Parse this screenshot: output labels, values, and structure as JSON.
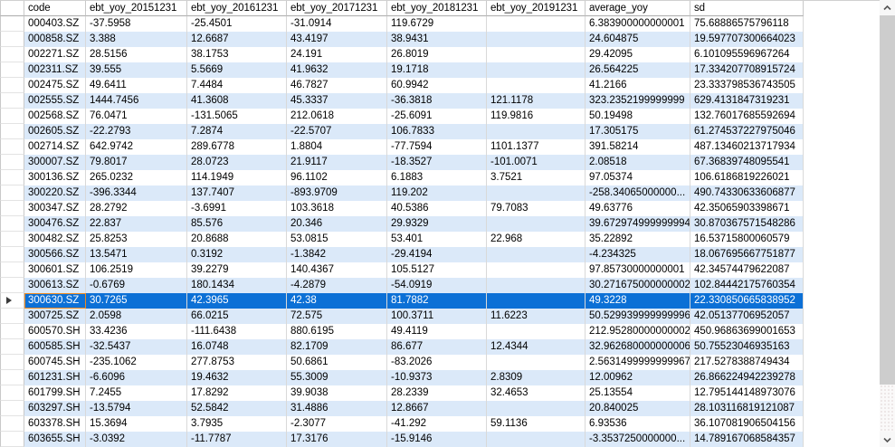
{
  "table": {
    "columns": [
      "code",
      "ebt_yoy_20151231",
      "ebt_yoy_20161231",
      "ebt_yoy_20171231",
      "ebt_yoy_20181231",
      "ebt_yoy_20191231",
      "average_yoy",
      "sd"
    ],
    "selected_index": 18,
    "rows": [
      [
        "000403.SZ",
        "-37.5958",
        "-25.4501",
        "-31.0914",
        "119.6729",
        "",
        "6.383900000000001",
        "75.68886575796118"
      ],
      [
        "000858.SZ",
        "3.388",
        "12.6687",
        "43.4197",
        "38.9431",
        "",
        "24.604875",
        "19.597707300664023"
      ],
      [
        "002271.SZ",
        "28.5156",
        "38.1753",
        "24.191",
        "26.8019",
        "",
        "29.42095",
        "6.101095596967264"
      ],
      [
        "002311.SZ",
        "39.555",
        "5.5669",
        "41.9632",
        "19.1718",
        "",
        "26.564225",
        "17.334207708915724"
      ],
      [
        "002475.SZ",
        "49.6411",
        "7.4484",
        "46.7827",
        "60.9942",
        "",
        "41.2166",
        "23.333798536743505"
      ],
      [
        "002555.SZ",
        "1444.7456",
        "41.3608",
        "45.3337",
        "-36.3818",
        "121.1178",
        "323.2352199999999",
        "629.4131847319231"
      ],
      [
        "002568.SZ",
        "76.0471",
        "-131.5065",
        "212.0618",
        "-25.6091",
        "119.9816",
        "50.19498",
        "132.76017685592694"
      ],
      [
        "002605.SZ",
        "-22.2793",
        "7.2874",
        "-22.5707",
        "106.7833",
        "",
        "17.305175",
        "61.274537227975046"
      ],
      [
        "002714.SZ",
        "642.9742",
        "289.6778",
        "1.8804",
        "-77.7594",
        "1101.1377",
        "391.58214",
        "487.13460213717934"
      ],
      [
        "300007.SZ",
        "79.8017",
        "28.0723",
        "21.9117",
        "-18.3527",
        "-101.0071",
        "2.08518",
        "67.36839748095541"
      ],
      [
        "300136.SZ",
        "265.0232",
        "114.1949",
        "96.1102",
        "6.1883",
        "3.7521",
        "97.05374",
        "106.6186819226021"
      ],
      [
        "300220.SZ",
        "-396.3344",
        "137.7407",
        "-893.9709",
        "119.202",
        "",
        "-258.34065000000...",
        "490.74330633606877"
      ],
      [
        "300347.SZ",
        "28.2792",
        "-3.6991",
        "103.3618",
        "40.5386",
        "79.7083",
        "49.63776",
        "42.35065903398671"
      ],
      [
        "300476.SZ",
        "22.837",
        "85.576",
        "20.346",
        "29.9329",
        "",
        "39.672974999999994",
        "30.870367571548286"
      ],
      [
        "300482.SZ",
        "25.8253",
        "20.8688",
        "53.0815",
        "53.401",
        "22.968",
        "35.22892",
        "16.53715800060579"
      ],
      [
        "300566.SZ",
        "13.5471",
        "0.3192",
        "-1.3842",
        "-29.4194",
        "",
        "-4.234325",
        "18.067695667751877"
      ],
      [
        "300601.SZ",
        "106.2519",
        "39.2279",
        "140.4367",
        "105.5127",
        "",
        "97.85730000000001",
        "42.34574479622087"
      ],
      [
        "300613.SZ",
        "-0.6769",
        "180.1434",
        "-4.2879",
        "-54.0919",
        "",
        "30.271675000000002",
        "102.84442175760354"
      ],
      [
        "300630.SZ",
        "30.7265",
        "42.3965",
        "42.38",
        "81.7882",
        "",
        "49.3228",
        "22.330850665838952"
      ],
      [
        "300725.SZ",
        "2.0598",
        "66.0215",
        "72.575",
        "100.3711",
        "11.6223",
        "50.529939999999996",
        "42.05137706952057"
      ],
      [
        "600570.SH",
        "33.4236",
        "-111.6438",
        "880.6195",
        "49.4119",
        "",
        "212.95280000000002",
        "450.96863699001653"
      ],
      [
        "600585.SH",
        "-32.5437",
        "16.0748",
        "82.1709",
        "86.677",
        "12.4344",
        "32.962680000000006",
        "50.75523046935163"
      ],
      [
        "600745.SH",
        "-235.1062",
        "277.8753",
        "50.6861",
        "-83.2026",
        "",
        "2.5631499999999967",
        "217.5278388749434"
      ],
      [
        "601231.SH",
        "-6.6096",
        "19.4632",
        "55.3009",
        "-10.9373",
        "2.8309",
        "12.00962",
        "26.866224942239278"
      ],
      [
        "601799.SH",
        "7.2455",
        "17.8292",
        "39.9038",
        "28.2339",
        "32.4653",
        "25.13554",
        "12.795144148973076"
      ],
      [
        "603297.SH",
        "-13.5794",
        "52.5842",
        "31.4886",
        "12.8667",
        "",
        "20.840025",
        "28.103116819121087"
      ],
      [
        "603378.SH",
        "15.3694",
        "3.7935",
        "-2.3077",
        "-41.292",
        "59.1136",
        "6.93536",
        "36.107081906504156"
      ],
      [
        "603655.SH",
        "-3.0392",
        "-11.7787",
        "17.3176",
        "-15.9146",
        "",
        "-3.3537250000000...",
        "14.789167068584357"
      ]
    ]
  },
  "colors": {
    "selection_blue": "#0c70d6",
    "selection_text": "#ffffff",
    "alt_row_blue": "#dbe9f9",
    "focus_cell_border": "#ec8a21",
    "grid_line": "#d9d9d9",
    "scrollbar_thumb": "#cdcdcd"
  },
  "icons": {
    "row_indicator": "current-row-arrow-icon",
    "scroll_up": "chevron-up-icon",
    "scroll_down": "chevron-down-icon"
  }
}
